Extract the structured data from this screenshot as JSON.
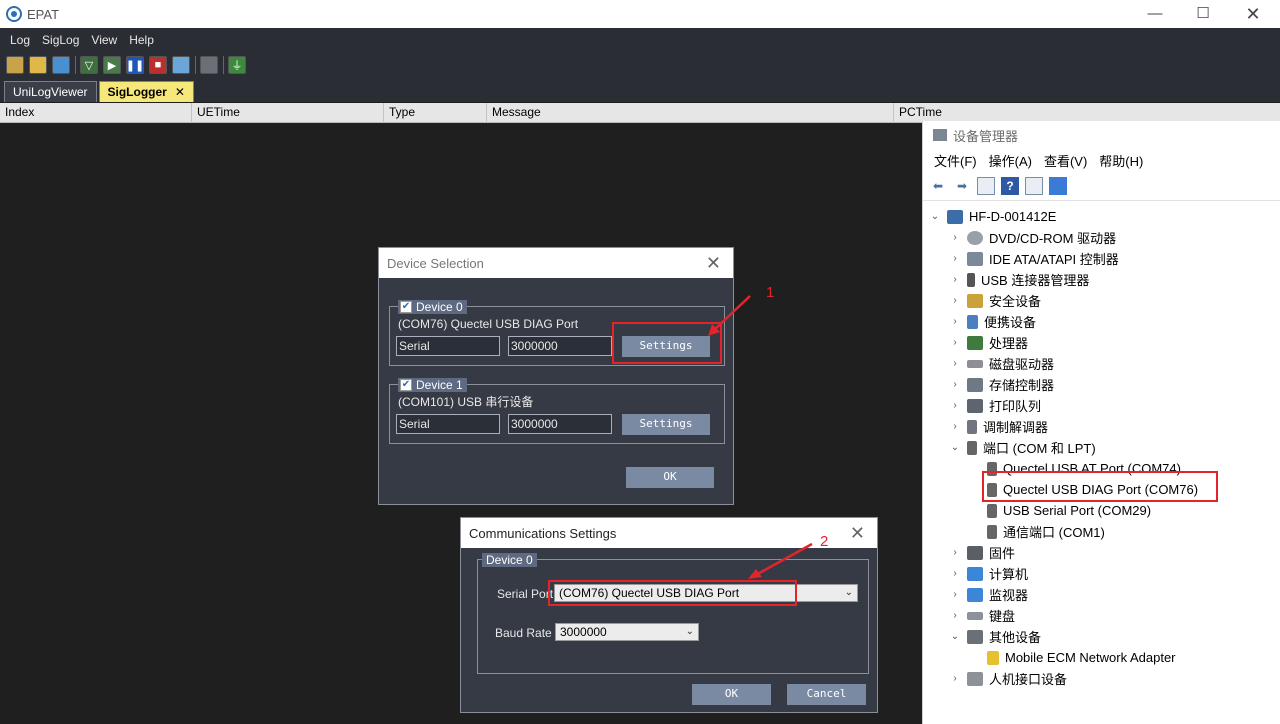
{
  "app": {
    "title": "EPAT"
  },
  "menu": [
    "Log",
    "SigLog",
    "View",
    "Help"
  ],
  "tabs": [
    {
      "label": "UniLogViewer"
    },
    {
      "label": "SigLogger",
      "close": "✕"
    }
  ],
  "table_headers": [
    "Index",
    "UETime",
    "Type",
    "Message",
    "PCTime"
  ],
  "device_manager": {
    "title": "设备管理器",
    "menu": [
      "文件(F)",
      "操作(A)",
      "查看(V)",
      "帮助(H)"
    ],
    "root": "HF-D-001412E",
    "items": [
      "DVD/CD-ROM 驱动器",
      "IDE ATA/ATAPI 控制器",
      "USB 连接器管理器",
      "安全设备",
      "便携设备",
      "处理器",
      "磁盘驱动器",
      "存储控制器",
      "打印队列",
      "调制解调器",
      "端口 (COM 和 LPT)",
      "Quectel USB AT Port (COM74)",
      "Quectel USB DIAG Port (COM76)",
      "USB Serial Port (COM29)",
      "通信端口 (COM1)",
      "固件",
      "计算机",
      "监视器",
      "键盘",
      "其他设备",
      "Mobile ECM Network Adapter",
      "人机接口设备"
    ]
  },
  "device_selection": {
    "title": "Device Selection",
    "ok": "OK",
    "devices": [
      {
        "legend": "Device 0",
        "name": "(COM76) Quectel USB DIAG Port",
        "type": "Serial",
        "baud": "3000000",
        "settings": "Settings"
      },
      {
        "legend": "Device 1",
        "name": "(COM101) USB 串行设备",
        "type": "Serial",
        "baud": "3000000",
        "settings": "Settings"
      }
    ]
  },
  "comm_settings": {
    "title": "Communications Settings",
    "legend": "Device 0",
    "serial_port_label": "Serial Port",
    "serial_port_value": "(COM76) Quectel USB DIAG Port",
    "baud_label": "Baud Rate",
    "baud_value": "3000000",
    "ok": "OK",
    "cancel": "Cancel"
  },
  "annotations": [
    "1",
    "2"
  ],
  "colors": {
    "accent": "#e3242b",
    "active_tab": "#f6e77a",
    "dialog_bg": "#353a45",
    "button": "#7b8aa3"
  }
}
